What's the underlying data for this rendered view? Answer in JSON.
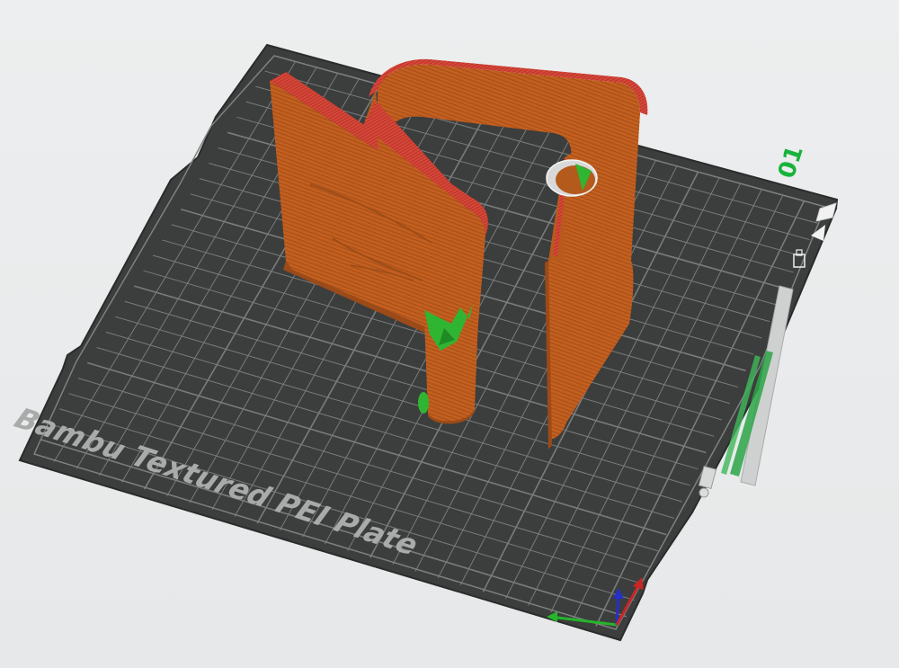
{
  "plate": {
    "label": "Bambu Textured PEI Plate",
    "number": "01"
  },
  "colors": {
    "plate": "#3c3d3d",
    "grid": "#8a8c8c",
    "model_face": "#c8601f",
    "model_top": "#d8483c",
    "support": "#2fb531",
    "plate_number": "#17b33b",
    "axis_x": "#25b52b",
    "axis_y": "#2530c8",
    "axis_z": "#c82525"
  },
  "icons": [
    "plate-orient-icon",
    "arrange-icon",
    "lock-icon",
    "layer-slider",
    "axis-gizmo"
  ]
}
